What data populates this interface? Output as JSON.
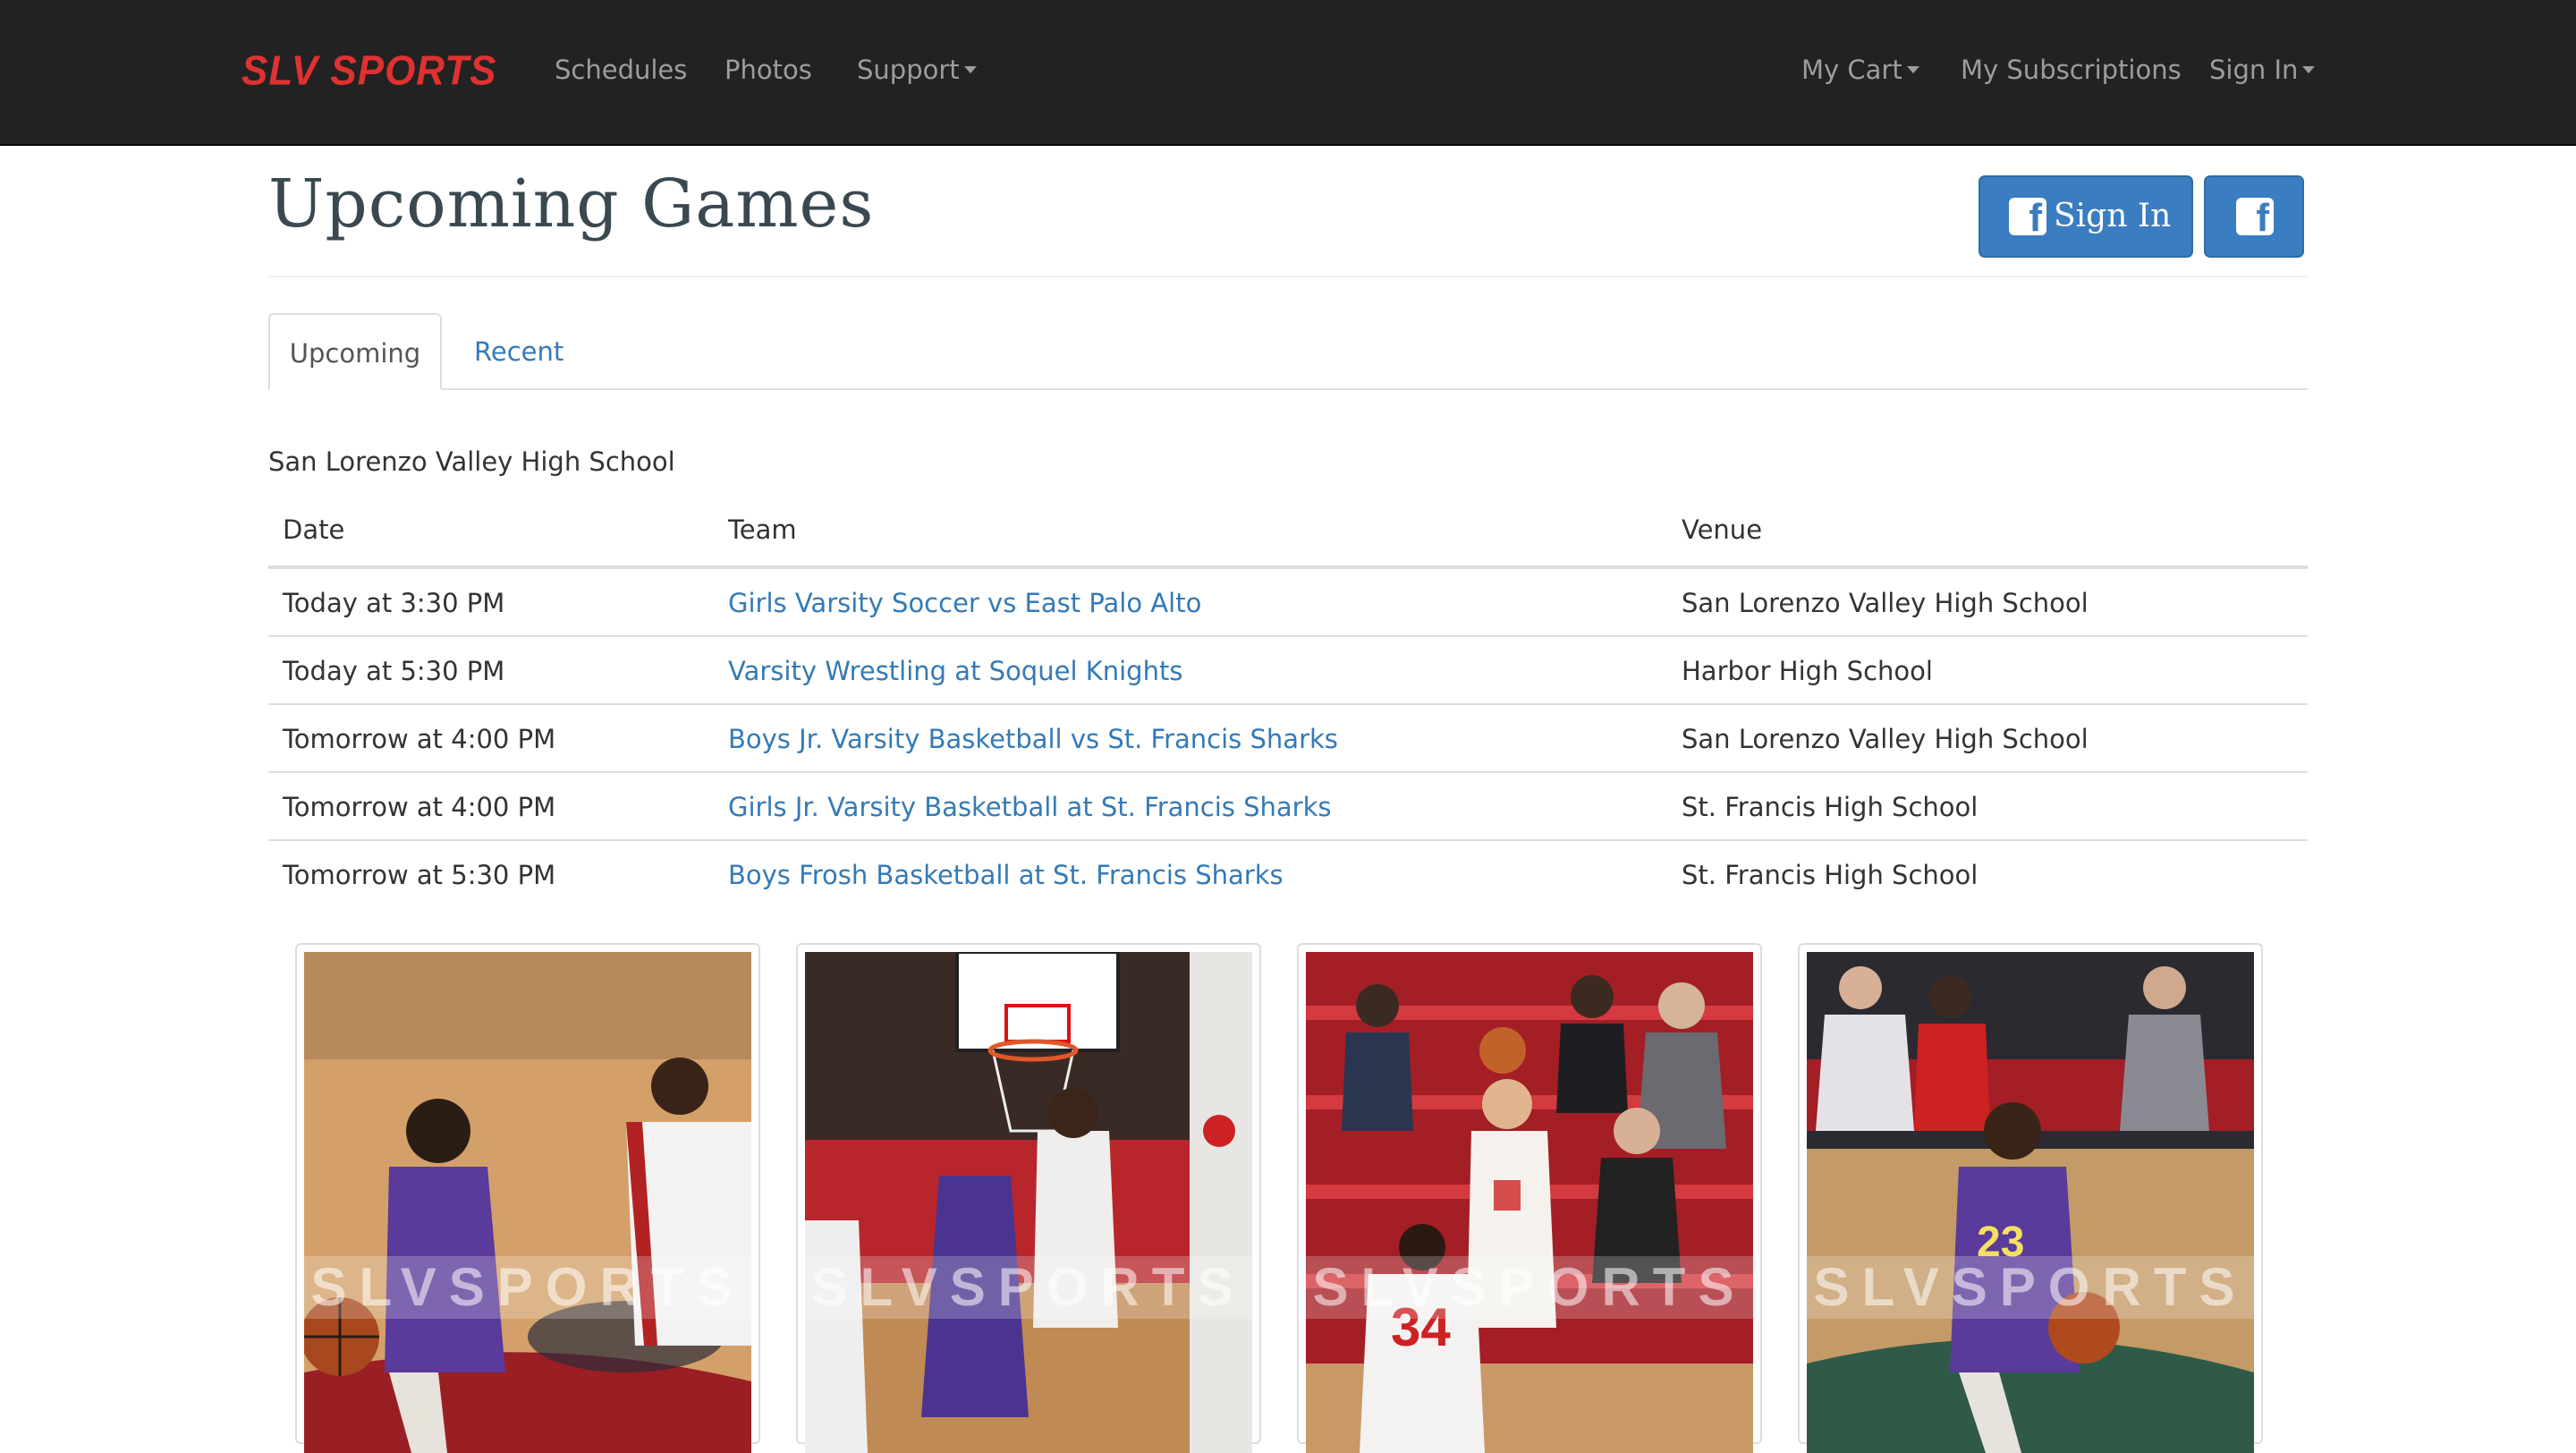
{
  "navbar": {
    "brand": "SLV SPORTS",
    "left_items": [
      "Schedules",
      "Photos",
      "Support"
    ],
    "right_items": [
      "My Cart",
      "My Subscriptions",
      "Sign In"
    ]
  },
  "header": {
    "title": "Upcoming Games",
    "fb_signin_label": "Sign In"
  },
  "tabs": [
    "Upcoming",
    "Recent"
  ],
  "school": "San Lorenzo Valley High School",
  "table": {
    "headers": [
      "Date",
      "Team",
      "Venue"
    ],
    "rows": [
      {
        "date": "Today at 3:30 PM",
        "team": "Girls Varsity Soccer vs East Palo Alto",
        "venue": "San Lorenzo Valley High School"
      },
      {
        "date": "Today at 5:30 PM",
        "team": "Varsity Wrestling at Soquel Knights",
        "venue": "Harbor High School"
      },
      {
        "date": "Tomorrow at 4:00 PM",
        "team": "Boys Jr. Varsity Basketball vs St. Francis Sharks",
        "venue": "San Lorenzo Valley High School"
      },
      {
        "date": "Tomorrow at 4:00 PM",
        "team": "Girls Jr. Varsity Basketball at St. Francis Sharks",
        "venue": "St. Francis High School"
      },
      {
        "date": "Tomorrow at 5:30 PM",
        "team": "Boys Frosh Basketball at St. Francis Sharks",
        "venue": "St. Francis High School"
      }
    ]
  },
  "photos": {
    "watermark": "SLVSPORTS",
    "items": [
      "basketball-photo-1",
      "basketball-photo-2",
      "basketball-photo-3",
      "basketball-photo-4"
    ]
  },
  "colors": {
    "navbar_bg": "#222222",
    "brand": "#e03131",
    "link": "#337ab7",
    "facebook": "#3a7dc0"
  }
}
